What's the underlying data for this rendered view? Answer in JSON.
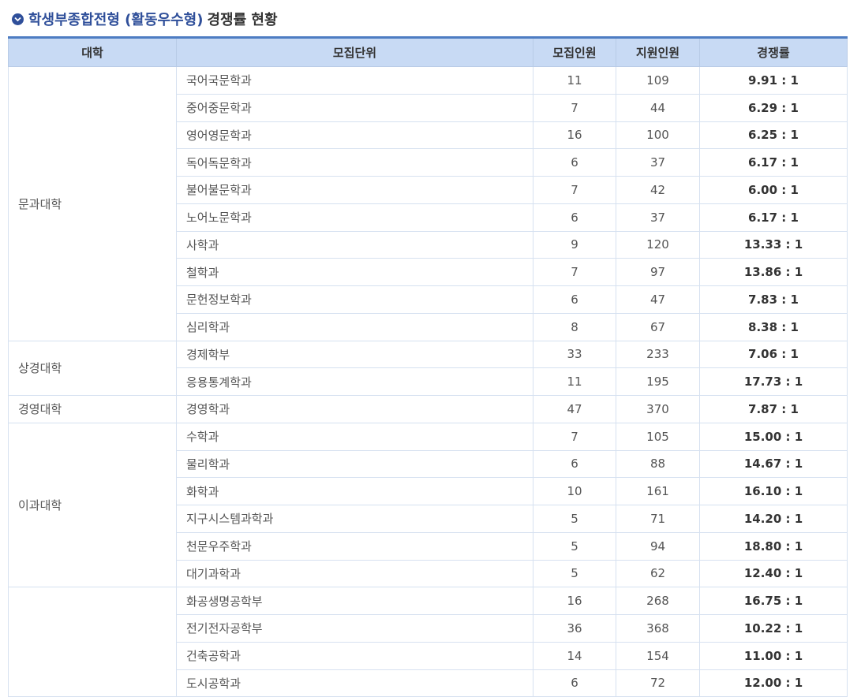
{
  "title": {
    "highlight": "학생부종합전형 (활동우수형)",
    "rest": "경쟁률 현황"
  },
  "columns": [
    "대학",
    "모집단위",
    "모집인원",
    "지원인원",
    "경쟁률"
  ],
  "groups": [
    {
      "college": "문과대학",
      "rows": [
        {
          "unit": "국어국문학과",
          "quota": "11",
          "applicants": "109",
          "rate": "9.91 : 1"
        },
        {
          "unit": "중어중문학과",
          "quota": "7",
          "applicants": "44",
          "rate": "6.29 : 1"
        },
        {
          "unit": "영어영문학과",
          "quota": "16",
          "applicants": "100",
          "rate": "6.25 : 1"
        },
        {
          "unit": "독어독문학과",
          "quota": "6",
          "applicants": "37",
          "rate": "6.17 : 1"
        },
        {
          "unit": "불어불문학과",
          "quota": "7",
          "applicants": "42",
          "rate": "6.00 : 1"
        },
        {
          "unit": "노어노문학과",
          "quota": "6",
          "applicants": "37",
          "rate": "6.17 : 1"
        },
        {
          "unit": "사학과",
          "quota": "9",
          "applicants": "120",
          "rate": "13.33 : 1"
        },
        {
          "unit": "철학과",
          "quota": "7",
          "applicants": "97",
          "rate": "13.86 : 1"
        },
        {
          "unit": "문헌정보학과",
          "quota": "6",
          "applicants": "47",
          "rate": "7.83 : 1"
        },
        {
          "unit": "심리학과",
          "quota": "8",
          "applicants": "67",
          "rate": "8.38 : 1"
        }
      ]
    },
    {
      "college": "상경대학",
      "rows": [
        {
          "unit": "경제학부",
          "quota": "33",
          "applicants": "233",
          "rate": "7.06 : 1"
        },
        {
          "unit": "응용통계학과",
          "quota": "11",
          "applicants": "195",
          "rate": "17.73 : 1"
        }
      ]
    },
    {
      "college": "경영대학",
      "rows": [
        {
          "unit": "경영학과",
          "quota": "47",
          "applicants": "370",
          "rate": "7.87 : 1"
        }
      ]
    },
    {
      "college": "이과대학",
      "rows": [
        {
          "unit": "수학과",
          "quota": "7",
          "applicants": "105",
          "rate": "15.00 : 1"
        },
        {
          "unit": "물리학과",
          "quota": "6",
          "applicants": "88",
          "rate": "14.67 : 1"
        },
        {
          "unit": "화학과",
          "quota": "10",
          "applicants": "161",
          "rate": "16.10 : 1"
        },
        {
          "unit": "지구시스템과학과",
          "quota": "5",
          "applicants": "71",
          "rate": "14.20 : 1"
        },
        {
          "unit": "천문우주학과",
          "quota": "5",
          "applicants": "94",
          "rate": "18.80 : 1"
        },
        {
          "unit": "대기과학과",
          "quota": "5",
          "applicants": "62",
          "rate": "12.40 : 1"
        }
      ]
    },
    {
      "college": "",
      "rows": [
        {
          "unit": "화공생명공학부",
          "quota": "16",
          "applicants": "268",
          "rate": "16.75 : 1"
        },
        {
          "unit": "전기전자공학부",
          "quota": "36",
          "applicants": "368",
          "rate": "10.22 : 1"
        },
        {
          "unit": "건축공학과",
          "quota": "14",
          "applicants": "154",
          "rate": "11.00 : 1"
        },
        {
          "unit": "도시공학과",
          "quota": "6",
          "applicants": "72",
          "rate": "12.00 : 1"
        }
      ]
    }
  ]
}
